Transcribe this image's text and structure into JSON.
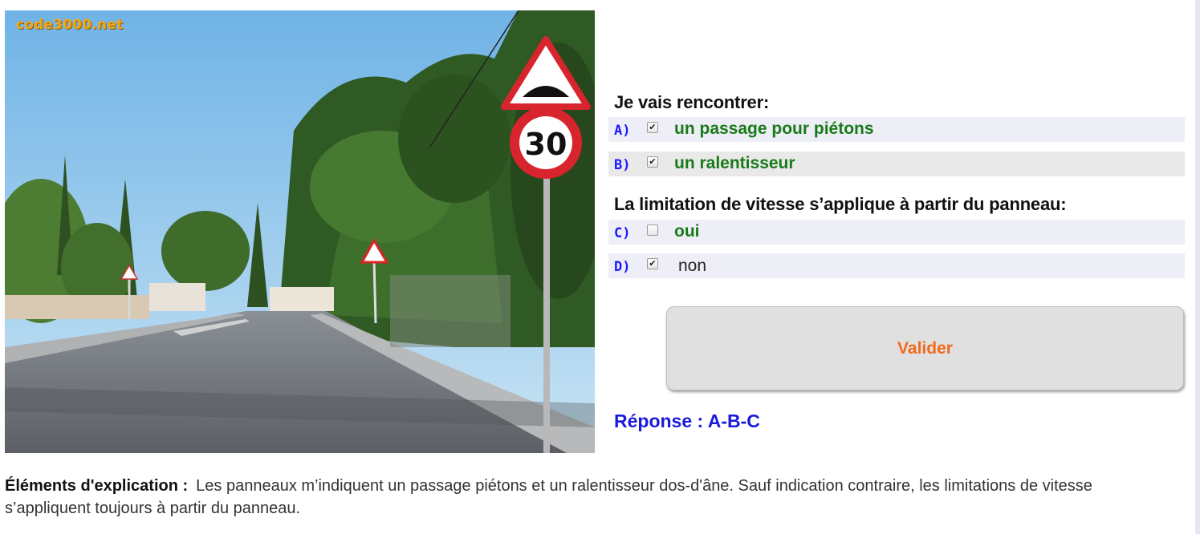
{
  "photo": {
    "watermark": "code3000.net",
    "speed_sign_value": "30"
  },
  "question1": {
    "heading": "Je vais rencontrer:"
  },
  "question2": {
    "heading": "La limitation de vitesse s’applique à partir du panneau:"
  },
  "options": [
    {
      "letter": "A)",
      "text": "un passage pour piétons",
      "checked": true,
      "correct": true
    },
    {
      "letter": "B)",
      "text": "un ralentisseur",
      "checked": true,
      "correct": true
    },
    {
      "letter": "C)",
      "text": "oui",
      "checked": false,
      "correct": true
    },
    {
      "letter": "D)",
      "text": "non",
      "checked": true,
      "correct": false
    }
  ],
  "validate_button": {
    "label": "Valider"
  },
  "answer": {
    "text": "Réponse : A-B-C"
  },
  "explanation": {
    "label": "Éléments d'explication :",
    "text": "Les panneaux m’indiquent un passage piétons et un ralentisseur dos-d'âne. Sauf indication contraire, les limitations de vitesse s’appliquent toujours à partir du panneau."
  },
  "colors": {
    "correct_answer": "#197a19",
    "option_letter": "#1a1aff",
    "validate_text": "#f26a1b",
    "answer_text": "#1a1add"
  }
}
